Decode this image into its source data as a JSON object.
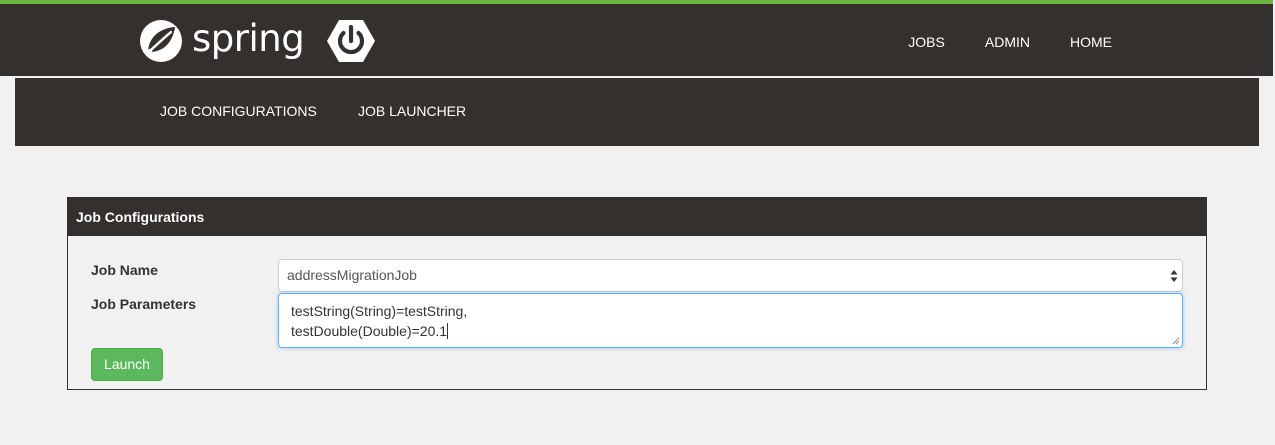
{
  "brand": {
    "name": "spring",
    "leaf_icon": "spring-leaf-icon",
    "hex_icon": "power-hexagon-icon"
  },
  "top_nav": {
    "items": [
      "JOBS",
      "ADMIN",
      "HOME"
    ]
  },
  "sub_nav": {
    "items": [
      "JOB CONFIGURATIONS",
      "JOB LAUNCHER"
    ]
  },
  "panel": {
    "title": "Job Configurations",
    "job_name_label": "Job Name",
    "job_name_value": "addressMigrationJob",
    "job_parameters_label": "Job Parameters",
    "job_parameters_lines": [
      "testString(String)=testString,",
      "testDouble(Double)=20.1"
    ],
    "launch_label": "Launch"
  },
  "colors": {
    "accent_green": "#6db33f",
    "bar_dark": "#34302d",
    "button_green": "#5cb85c",
    "focus_blue": "#66afe9",
    "page_background": "#f1f1f1"
  }
}
